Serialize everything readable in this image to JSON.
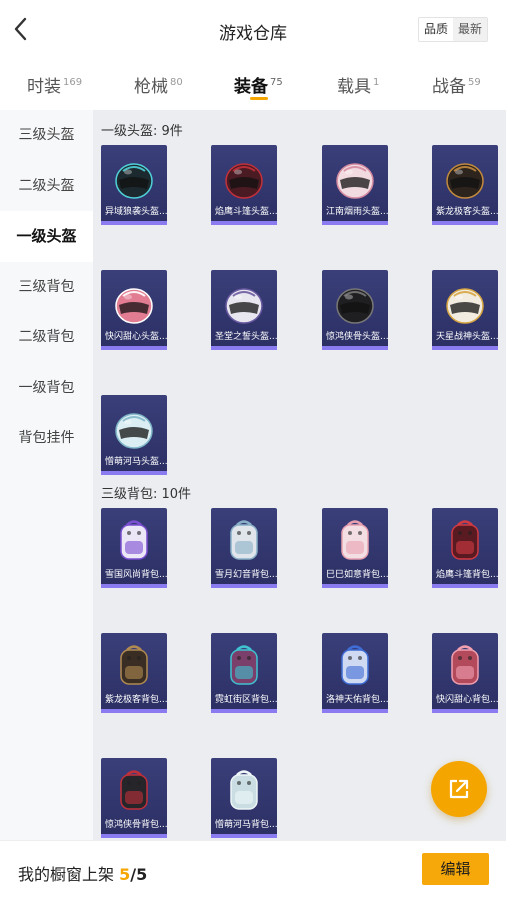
{
  "header": {
    "title": "游戏仓库",
    "sort_options": [
      "品质",
      "最新"
    ]
  },
  "tabs": [
    {
      "label": "时装",
      "count": "169"
    },
    {
      "label": "枪械",
      "count": "80"
    },
    {
      "label": "装备",
      "count": "75",
      "active": true
    },
    {
      "label": "载具",
      "count": "1"
    },
    {
      "label": "战备",
      "count": "59"
    }
  ],
  "sidebar": {
    "items": [
      "三级头盔",
      "二级头盔",
      "一级头盔",
      "三级背包",
      "二级背包",
      "一级背包",
      "背包挂件"
    ],
    "active_index": 2
  },
  "sections": [
    {
      "title": "一级头盔: 9件",
      "items": [
        {
          "name": "异域狼袭头盔...",
          "kind": "helmet",
          "color": "#1c2a2f",
          "accent": "#4fd0d8"
        },
        {
          "name": "焰鹰斗篷头盔...",
          "kind": "helmet",
          "color": "#4b1b24",
          "accent": "#c2303a"
        },
        {
          "name": "江南烟雨头盔...",
          "kind": "helmet",
          "color": "#f1dbe1",
          "accent": "#d58aa0"
        },
        {
          "name": "紫龙极客头盔...",
          "kind": "helmet",
          "color": "#2d241e",
          "accent": "#c28a3e"
        },
        {
          "name": "快闪甜心头盔...",
          "kind": "helmet",
          "color": "#e27c93",
          "accent": "#ffffff"
        },
        {
          "name": "圣堂之誓头盔...",
          "kind": "helmet",
          "color": "#e8e6ef",
          "accent": "#6a5aa0"
        },
        {
          "name": "惊鸿侠骨头盔...",
          "kind": "helmet",
          "color": "#1f1f22",
          "accent": "#777777"
        },
        {
          "name": "天星战神头盔...",
          "kind": "helmet",
          "color": "#f2ece0",
          "accent": "#d7a541"
        },
        {
          "name": "憎萌河马头盔...",
          "kind": "helmet",
          "color": "#dbeef4",
          "accent": "#7fb6c8"
        }
      ]
    },
    {
      "title": "三级背包: 10件",
      "items": [
        {
          "name": "雪国风尚背包...",
          "kind": "backpack",
          "color": "#ece7f7",
          "accent": "#7b4fd1"
        },
        {
          "name": "雪月幻音背包...",
          "kind": "backpack",
          "color": "#dfe5ea",
          "accent": "#8ab0c8"
        },
        {
          "name": "巳巳如意背包...",
          "kind": "backpack",
          "color": "#f3dfe3",
          "accent": "#e7a0b0"
        },
        {
          "name": "焰鹰斗篷背包...",
          "kind": "backpack",
          "color": "#5a1a22",
          "accent": "#d23a42"
        },
        {
          "name": "紫龙极客背包...",
          "kind": "backpack",
          "color": "#3a2e24",
          "accent": "#b08a50"
        },
        {
          "name": "霓虹街区背包...",
          "kind": "backpack",
          "color": "#7a3f6a",
          "accent": "#3fc3d0"
        },
        {
          "name": "洛神天佑背包...",
          "kind": "backpack",
          "color": "#cfdaf2",
          "accent": "#3f6dd6"
        },
        {
          "name": "快闪甜心背包...",
          "kind": "backpack",
          "color": "#b24a5c",
          "accent": "#f2a0b0"
        },
        {
          "name": "惊鸿侠骨背包...",
          "kind": "backpack",
          "color": "#26252a",
          "accent": "#c0303a"
        },
        {
          "name": "憎萌河马背包...",
          "kind": "backpack",
          "color": "#c9dde3",
          "accent": "#eef6f8"
        }
      ]
    }
  ],
  "footer": {
    "shelf_label": "我的橱窗上架",
    "shelf_current": "5",
    "shelf_total": "/5",
    "edit_label": "编辑"
  },
  "colors": {
    "accent": "#f5a600",
    "tile_bg": "#2e3268",
    "tile_bar": "#8a7cf0",
    "content_bg": "#ebedf0"
  },
  "icons": {
    "back": "chevron-left-icon",
    "share": "share-external-icon"
  }
}
